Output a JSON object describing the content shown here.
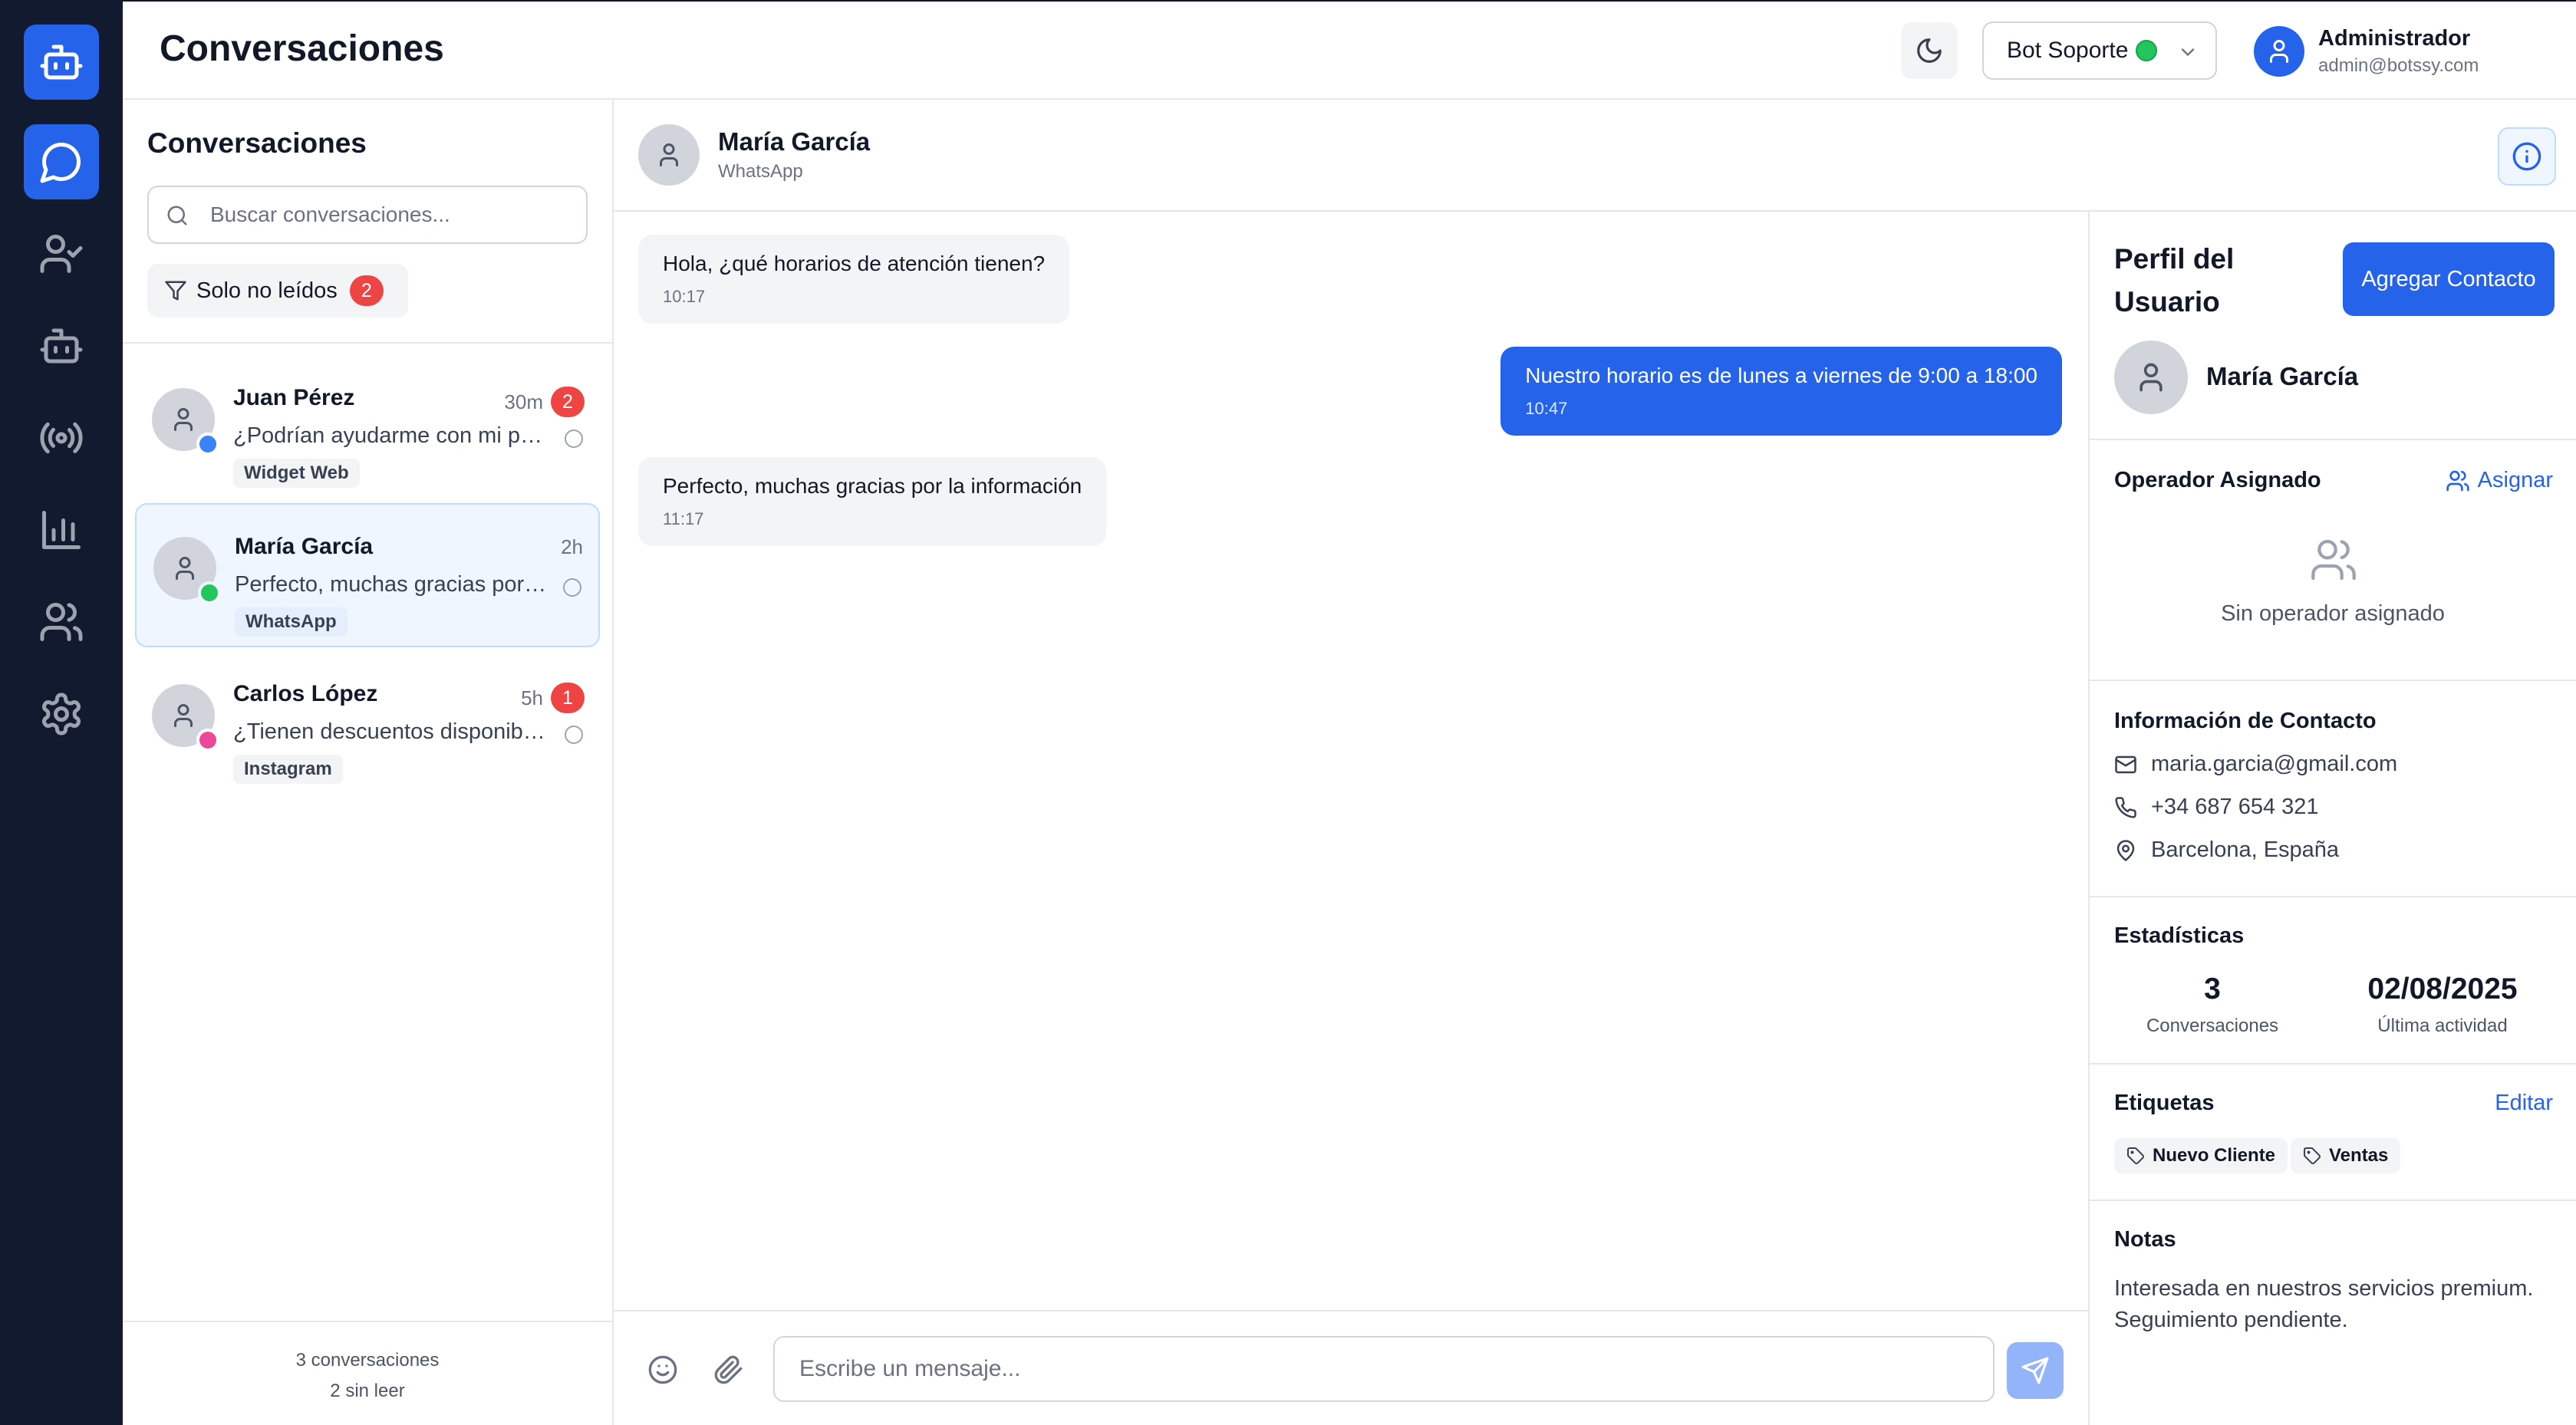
{
  "colors": {
    "accent": "#2563eb",
    "sidebar": "#111a2e",
    "unread_badge": "#ef4444",
    "online": "#22c55e"
  },
  "nav": {
    "items": [
      {
        "icon": "bot-logo-icon"
      },
      {
        "icon": "chat-bubble-icon",
        "active": true
      },
      {
        "icon": "user-check-icon"
      },
      {
        "icon": "bot-icon"
      },
      {
        "icon": "broadcast-icon"
      },
      {
        "icon": "bar-chart-icon"
      },
      {
        "icon": "users-icon"
      },
      {
        "icon": "settings-gear-icon"
      }
    ]
  },
  "header": {
    "title": "Conversaciones",
    "bot_select": {
      "label": "Bot Soporte",
      "status": "online"
    },
    "user": {
      "name": "Administrador",
      "email": "admin@botssy.com"
    }
  },
  "list": {
    "title": "Conversaciones",
    "search_placeholder": "Buscar conversaciones...",
    "filter": {
      "label": "Solo no leídos",
      "count": "2"
    },
    "conversations": [
      {
        "name": "Juan Pérez",
        "time": "30m",
        "unread": "2",
        "preview": "¿Podrían ayudarme con mi pedido?",
        "channel": "Widget Web",
        "status_color": "#3b82f6"
      },
      {
        "name": "María García",
        "time": "2h",
        "unread": "",
        "preview": "Perfecto, muchas gracias por la información",
        "channel": "WhatsApp",
        "status_color": "#22c55e",
        "selected": true
      },
      {
        "name": "Carlos López",
        "time": "5h",
        "unread": "1",
        "preview": "¿Tienen descuentos disponibles?",
        "channel": "Instagram",
        "status_color": "#ec4899"
      }
    ],
    "footer": {
      "total": "3 conversaciones",
      "unread": "2 sin leer"
    }
  },
  "chat": {
    "contact_name": "María García",
    "channel": "WhatsApp",
    "messages": [
      {
        "direction": "in",
        "text": "Hola, ¿qué horarios de atención tienen?",
        "time": "10:17"
      },
      {
        "direction": "out",
        "text": "Nuestro horario es de lunes a viernes de 9:00 a 18:00",
        "time": "10:47"
      },
      {
        "direction": "in",
        "text": "Perfecto, muchas gracias por la información",
        "time": "11:17"
      }
    ],
    "composer_placeholder": "Escribe un mensaje..."
  },
  "profile": {
    "title": "Perfil del Usuario",
    "add_contact_label": "Agregar Contacto",
    "name": "María García",
    "operator": {
      "title": "Operador Asignado",
      "assign_label": "Asignar",
      "empty_text": "Sin operador asignado"
    },
    "contact_info": {
      "title": "Información de Contacto",
      "email": "maria.garcia@gmail.com",
      "phone": "+34 687 654 321",
      "location": "Barcelona, España"
    },
    "stats": {
      "title": "Estadísticas",
      "conversations_value": "3",
      "conversations_label": "Conversaciones",
      "last_activity_value": "02/08/2025",
      "last_activity_label": "Última actividad"
    },
    "tags": {
      "title": "Etiquetas",
      "edit_label": "Editar",
      "items": [
        "Nuevo Cliente",
        "Ventas"
      ]
    },
    "notes": {
      "title": "Notas",
      "text": "Interesada en nuestros servicios premium. Seguimiento pendiente."
    }
  }
}
